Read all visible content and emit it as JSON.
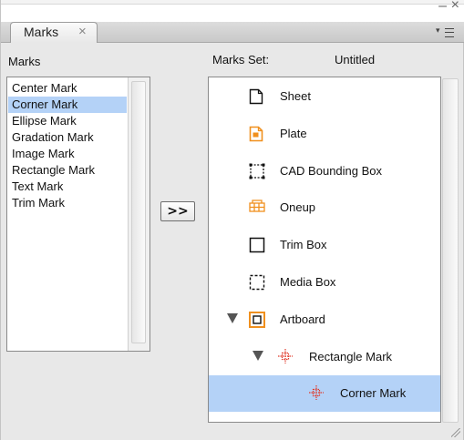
{
  "panel": {
    "tab_label": "Marks",
    "tab_close": "×",
    "minimize_glyph": "–",
    "close_glyph": "×"
  },
  "left": {
    "heading": "Marks",
    "items": [
      {
        "label": "Center Mark",
        "selected": false
      },
      {
        "label": "Corner Mark",
        "selected": true
      },
      {
        "label": "Ellipse Mark",
        "selected": false
      },
      {
        "label": "Gradation Mark",
        "selected": false
      },
      {
        "label": "Image Mark",
        "selected": false
      },
      {
        "label": "Rectangle Mark",
        "selected": false
      },
      {
        "label": "Text Mark",
        "selected": false
      },
      {
        "label": "Trim Mark",
        "selected": false
      }
    ]
  },
  "add_button_label": ">>",
  "right": {
    "heading": "Marks Set:",
    "set_name": "Untitled",
    "tree": [
      {
        "label": "Sheet",
        "icon": "sheet-icon",
        "level": 0,
        "expander": "none",
        "selected": false
      },
      {
        "label": "Plate",
        "icon": "plate-icon",
        "level": 0,
        "expander": "none",
        "selected": false
      },
      {
        "label": "CAD Bounding Box",
        "icon": "cad-bounding-box-icon",
        "level": 0,
        "expander": "none",
        "selected": false
      },
      {
        "label": "Oneup",
        "icon": "oneup-icon",
        "level": 0,
        "expander": "none",
        "selected": false
      },
      {
        "label": "Trim Box",
        "icon": "trim-box-icon",
        "level": 0,
        "expander": "none",
        "selected": false
      },
      {
        "label": "Media Box",
        "icon": "media-box-icon",
        "level": 0,
        "expander": "none",
        "selected": false
      },
      {
        "label": "Artboard",
        "icon": "artboard-icon",
        "level": 0,
        "expander": "expanded",
        "selected": false
      },
      {
        "label": "Rectangle Mark",
        "icon": "rectangle-mark-icon",
        "level": 1,
        "expander": "expanded",
        "selected": false
      },
      {
        "label": "Corner Mark",
        "icon": "corner-mark-icon",
        "level": 2,
        "expander": "none",
        "selected": true
      }
    ]
  },
  "colors": {
    "selection": "#b4d2f7",
    "accent_orange": "#f0901e",
    "mark_red": "#e03a2a"
  }
}
